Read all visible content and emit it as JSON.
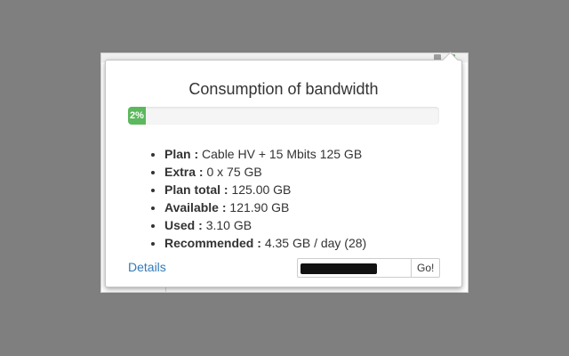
{
  "popup": {
    "title": "Consumption of bandwidth",
    "progress": {
      "percent": 2,
      "label": "2%",
      "color": "#5cb85c"
    },
    "stats": [
      {
        "label": "Plan :",
        "value": "Cable HV + 15 Mbits 125 GB"
      },
      {
        "label": "Extra :",
        "value": "0 x 75 GB"
      },
      {
        "label": "Plan total :",
        "value": "125.00 GB"
      },
      {
        "label": "Available :",
        "value": "121.90 GB"
      },
      {
        "label": "Used :",
        "value": "3.10 GB"
      },
      {
        "label": "Recommended :",
        "value": "4.35 GB / day (28)"
      }
    ],
    "details_link": "Details",
    "account_input": {
      "value": "",
      "redacted": true
    },
    "go_button": "Go!"
  },
  "colors": {
    "link": "#337ab7",
    "background": "#7f7f7f"
  }
}
